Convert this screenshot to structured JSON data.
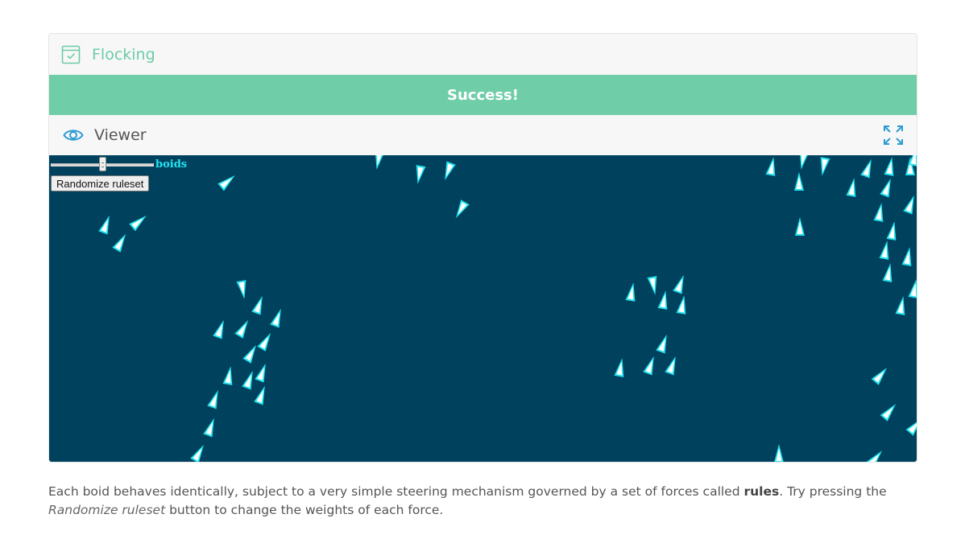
{
  "card": {
    "title": "Flocking",
    "success_message": "Success!"
  },
  "viewer": {
    "title": "Viewer"
  },
  "controls": {
    "slider_label": "boids",
    "slider_value_fraction": 0.5,
    "randomize_label": "Randomize ruleset"
  },
  "description": {
    "part1": "Each boid behaves identically, subject to a very simple steering mechanism governed by a set of forces called ",
    "bold": "rules",
    "part2": ". Try pressing the ",
    "italic": "Randomize ruleset",
    "part3": " button to change the weights of each force."
  },
  "colors": {
    "accent_green": "#6fcea8",
    "canvas_bg": "#00425e",
    "boid_fill": "#22e4f0",
    "icon_blue": "#2c9bd3"
  },
  "icons": {
    "card": "checkbox-icon",
    "viewer": "eye-icon",
    "expand": "expand-icon"
  }
}
